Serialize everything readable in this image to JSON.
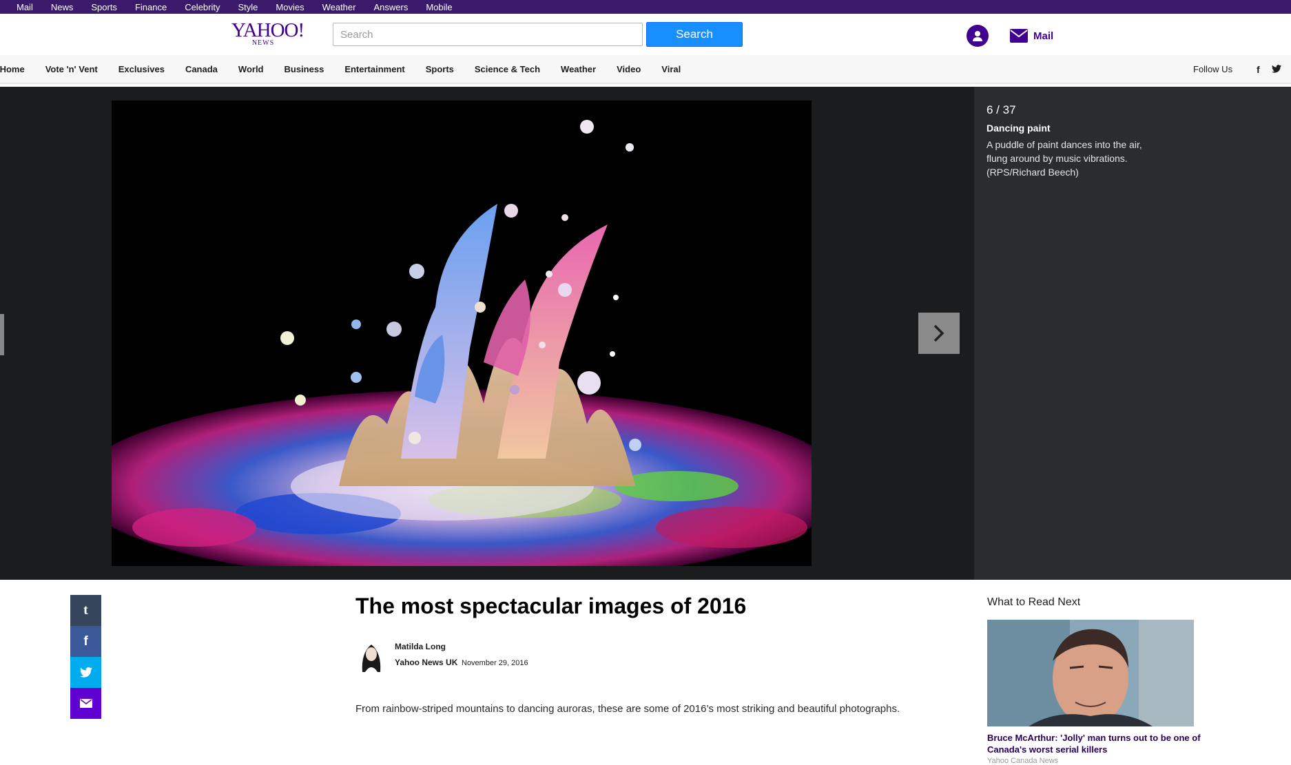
{
  "topbar": {
    "links": [
      "Mail",
      "News",
      "Sports",
      "Finance",
      "Celebrity",
      "Style",
      "Movies",
      "Weather",
      "Answers",
      "Mobile"
    ]
  },
  "header": {
    "logo_main": "YAHOO!",
    "logo_sub": "NEWS",
    "search_placeholder": "Search",
    "search_button": "Search",
    "mail_label": "Mail"
  },
  "nav": {
    "items": [
      "News Home",
      "Vote 'n' Vent",
      "Exclusives",
      "Canada",
      "World",
      "Business",
      "Entertainment",
      "Sports",
      "Science & Tech",
      "Weather",
      "Video",
      "Viral"
    ],
    "follow_label": "Follow Us"
  },
  "slideshow": {
    "counter": "6 / 37",
    "caption_title": "Dancing paint",
    "caption_text": "A puddle of paint dances into the air, flung around by music vibrations. (RPS/Richard Beech)"
  },
  "article": {
    "headline": "The most spectacular images of 2016",
    "author": "Matilda Long",
    "publisher": "Yahoo News UK",
    "date": "November 29, 2016",
    "intro": "From rainbow-striped mountains to dancing auroras, these are some of 2016’s most striking and beautiful photographs."
  },
  "read_next": {
    "title": "What to Read Next",
    "headline": "Bruce McArthur: 'Jolly' man turns out to be one of Canada's worst serial killers",
    "source": "Yahoo Canada News"
  },
  "colors": {
    "brand_purple": "#400090",
    "search_blue": "#188fff",
    "tumblr": "#35465c",
    "facebook": "#3b5998",
    "twitter": "#00aced",
    "mail": "#5f01d1"
  }
}
